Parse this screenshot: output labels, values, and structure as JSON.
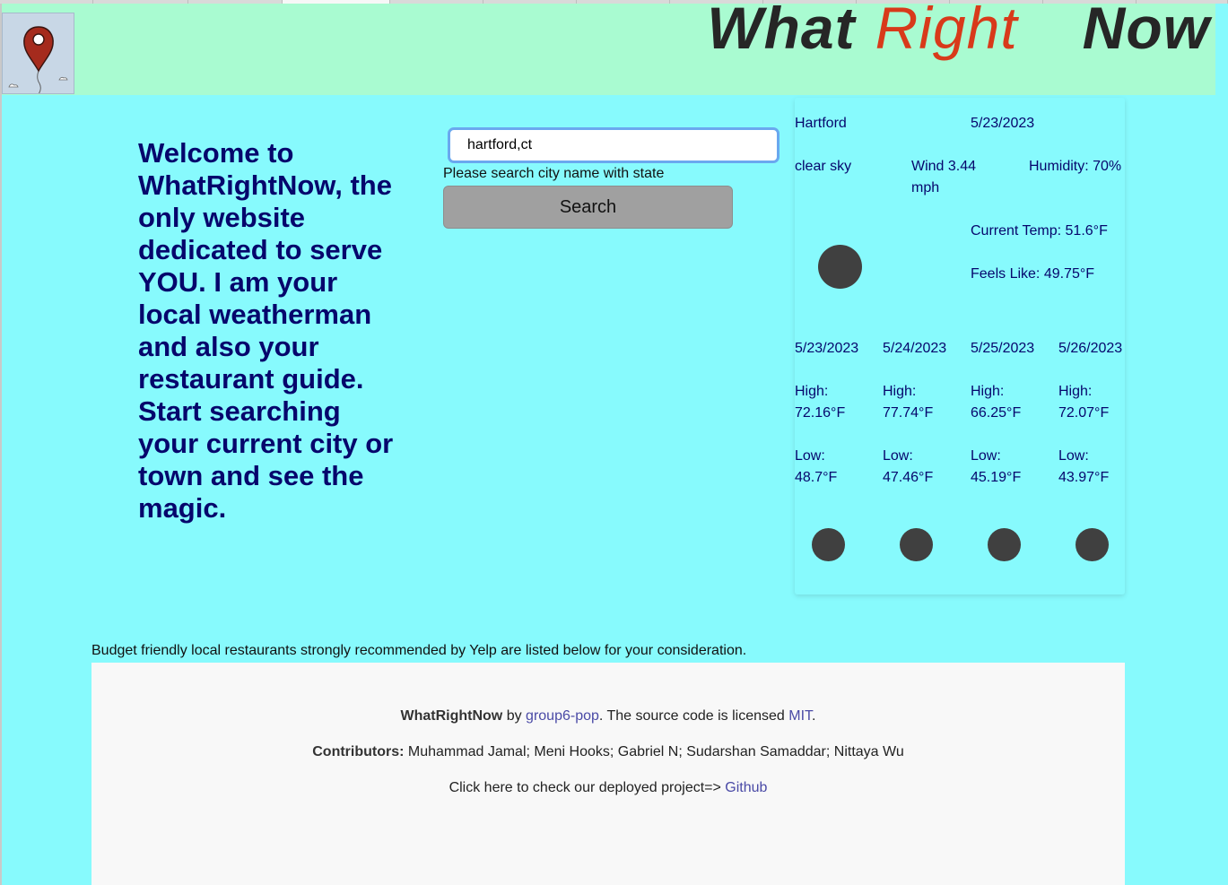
{
  "header": {
    "title_part1": "What",
    "title_part2": "Right",
    "title_part3": "Now",
    "logo": "map-pin-balloon-icon"
  },
  "welcome": {
    "text": "Welcome to WhatRightNow, the only website dedicated to serve YOU. I am your local weatherman and also your restaurant guide. Start searching your current city or town and see the magic."
  },
  "search": {
    "value": "hartford,ct",
    "hint": "Please search city name with state",
    "button_label": "Search"
  },
  "weather": {
    "city": "Hartford",
    "date": "5/23/2023",
    "description": "clear sky",
    "wind": "Wind 3.44 mph",
    "humidity": "Humidity: 70%",
    "current_temp": "Current Temp: 51.6°F",
    "feels_like": "Feels Like: 49.75°F",
    "icon": "weather-icon",
    "forecast": [
      {
        "date": "5/23/2023",
        "high": "High: 72.16°F",
        "low": "Low: 48.7°F"
      },
      {
        "date": "5/24/2023",
        "high": "High: 77.74°F",
        "low": "Low: 47.46°F"
      },
      {
        "date": "5/25/2023",
        "high": "High: 66.25°F",
        "low": "Low: 45.19°F"
      },
      {
        "date": "5/26/2023",
        "high": "High: 72.07°F",
        "low": "Low: 43.97°F"
      }
    ]
  },
  "restaurants": {
    "intro": "Budget friendly local restaurants strongly recommended by Yelp are listed below for your consideration."
  },
  "footer": {
    "brand": "WhatRightNow",
    "by": " by ",
    "author_link": "group6-pop",
    "license_text": ". The source code is licensed ",
    "license_link": "MIT",
    "license_end": ".",
    "contributors_label": "Contributors:",
    "contributors": " Muhammad Jamal; Meni Hooks; Gabriel N; Sudarshan Samaddar; Nittaya Wu",
    "deploy_text": "Click here to check our deployed project=> ",
    "deploy_link": "Github"
  },
  "colors": {
    "page_bg": "#87fafd",
    "header_bg": "#a9fbd1",
    "title_accent": "#d83a1a",
    "text_navy": "#06066c",
    "button_gray": "#a0a0a0",
    "link": "#4a4aa6"
  }
}
